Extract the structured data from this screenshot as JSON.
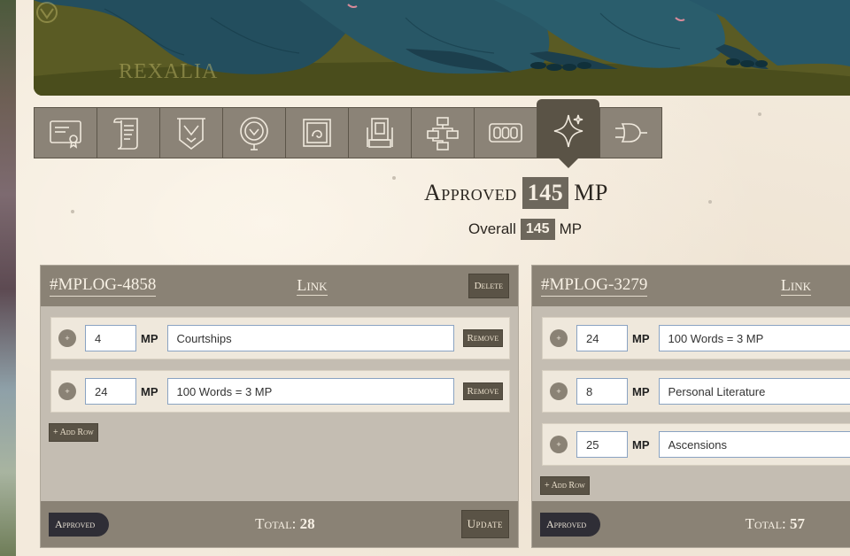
{
  "banner": {
    "logo_text": "REXALIA"
  },
  "tabs": [
    {
      "name": "certificate-icon",
      "active": false
    },
    {
      "name": "scroll-icon",
      "active": false
    },
    {
      "name": "crest-banner-icon",
      "active": false
    },
    {
      "name": "medallion-icon",
      "active": false
    },
    {
      "name": "portrait-frame-icon",
      "active": false
    },
    {
      "name": "shrine-icon",
      "active": false
    },
    {
      "name": "flowchart-icon",
      "active": false
    },
    {
      "name": "triple-panel-icon",
      "active": false
    },
    {
      "name": "sparkle-icon",
      "active": true
    },
    {
      "name": "logic-gate-icon",
      "active": false
    }
  ],
  "summary": {
    "approved_label": "Approved",
    "approved_value": "145",
    "approved_unit": "MP",
    "overall_label": "Overall",
    "overall_value": "145",
    "overall_unit": "MP"
  },
  "logs": [
    {
      "id": "#MPLOG-4858",
      "link_label": "Link",
      "delete_label": "Delete",
      "rows": [
        {
          "plus": "+",
          "amount": "4",
          "unit": "MP",
          "desc": "Courtships",
          "remove_label": "Remove"
        },
        {
          "plus": "+",
          "amount": "24",
          "unit": "MP",
          "desc": "100 Words = 3 MP",
          "remove_label": "Remove"
        }
      ],
      "add_row_label": "+ Add Row",
      "status": "Approved",
      "total_label": "Total:",
      "total_value": "28",
      "update_label": "Update"
    },
    {
      "id": "#MPLOG-3279",
      "link_label": "Link",
      "rows": [
        {
          "plus": "+",
          "amount": "24",
          "unit": "MP",
          "desc": "100 Words = 3 MP"
        },
        {
          "plus": "+",
          "amount": "8",
          "unit": "MP",
          "desc": "Personal Literature"
        },
        {
          "plus": "+",
          "amount": "25",
          "unit": "MP",
          "desc": "Ascensions"
        }
      ],
      "add_row_label": "+ Add Row",
      "status": "Approved",
      "total_label": "Total:",
      "total_value": "57"
    }
  ],
  "colors": {
    "panel_header": "#8a8275",
    "panel_body": "#c4bdb2",
    "button_dark": "#5a5346",
    "status_pill": "#2f2e36",
    "page_bg": "#f3eadc"
  }
}
